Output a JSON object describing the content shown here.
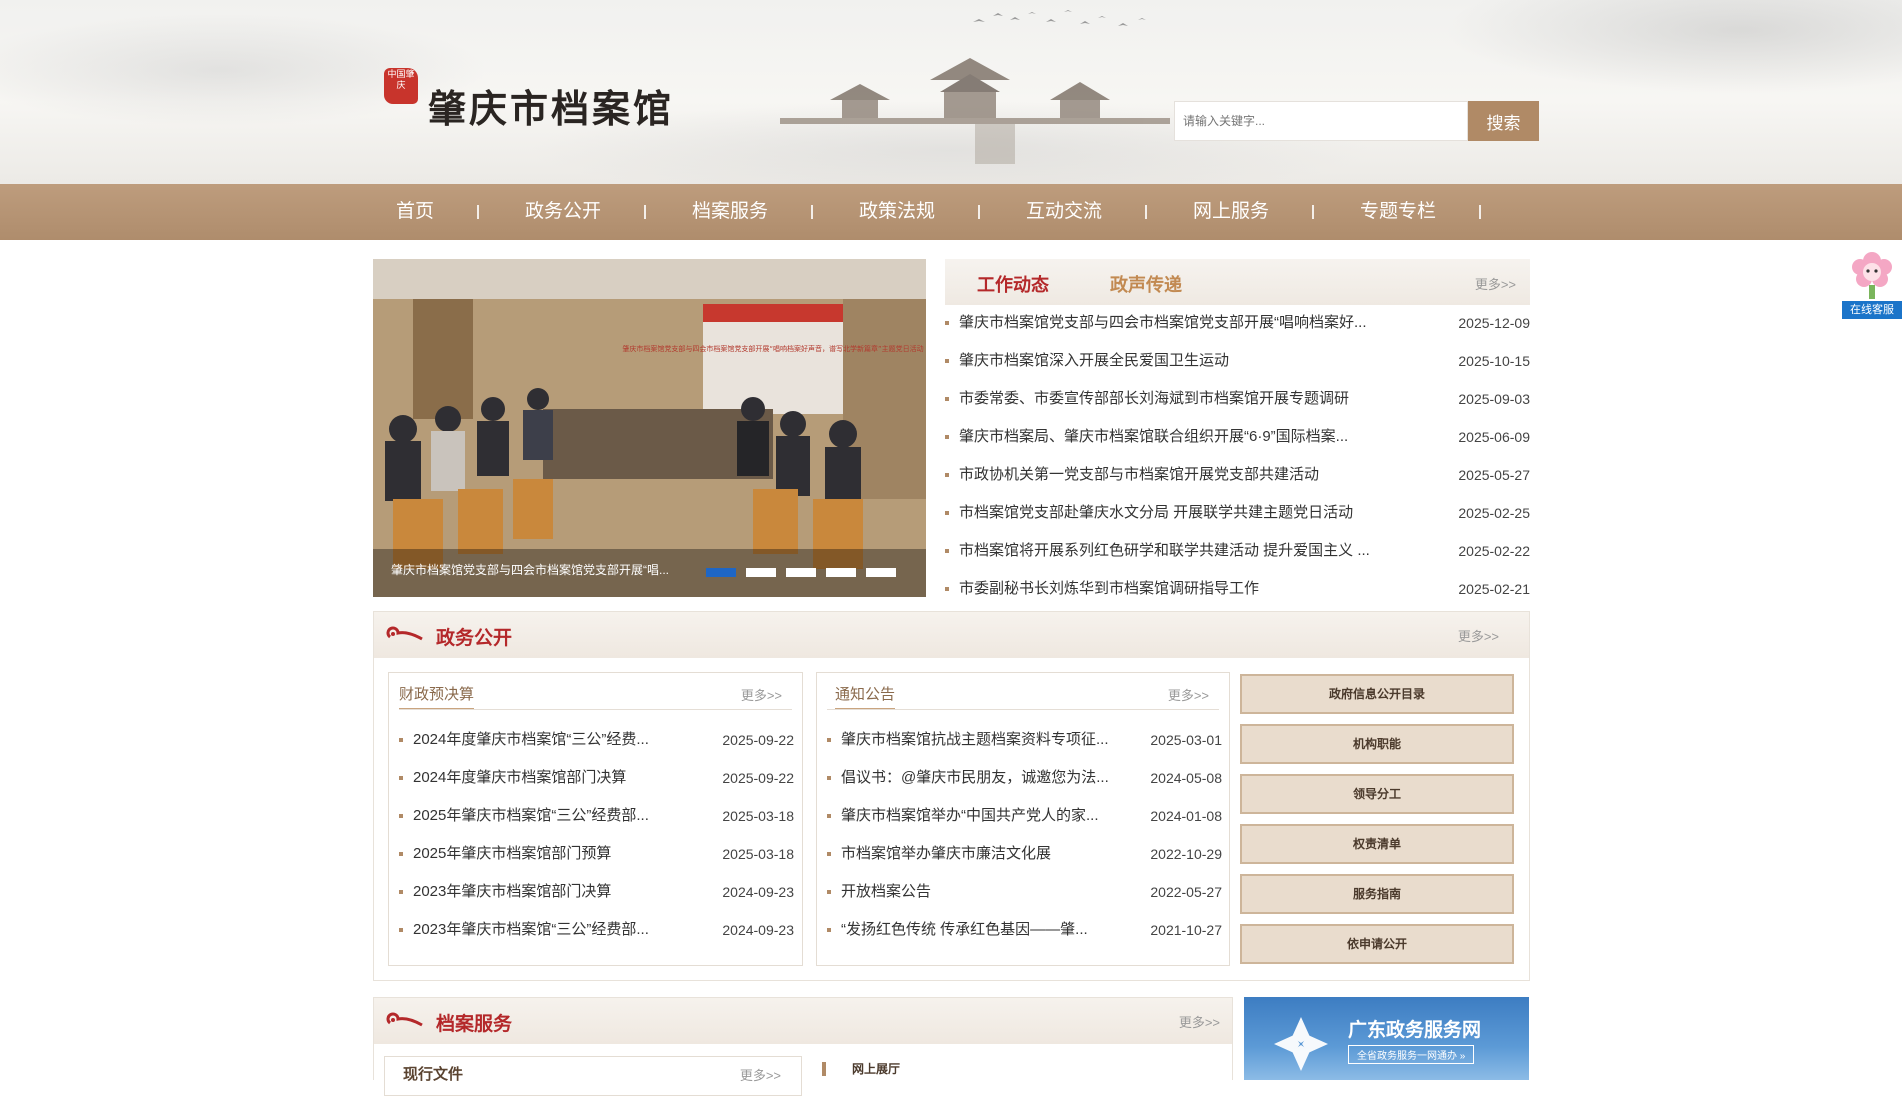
{
  "header": {
    "seal_text": "中国肇庆",
    "site_title": "肇庆市档案馆",
    "search": {
      "placeholder": "请输入关键字...",
      "button_label": "搜索"
    }
  },
  "nav": {
    "items": [
      {
        "label": "首页"
      },
      {
        "label": "政务公开"
      },
      {
        "label": "档案服务"
      },
      {
        "label": "政策法规"
      },
      {
        "label": "互动交流"
      },
      {
        "label": "网上服务"
      },
      {
        "label": "专题专栏"
      }
    ]
  },
  "carousel": {
    "caption": "肇庆市档案馆党支部与四会市档案馆党支部开展“唱...",
    "slide_count": 5,
    "active_index": 0,
    "slide_banner_text": "肇庆市档案馆党支部与四会市档案馆党支部开展“唱响档案好声音，谱写北学新篇章”主题党日活动"
  },
  "news": {
    "tabs": [
      {
        "label": "工作动态",
        "active": true
      },
      {
        "label": "政声传递",
        "active": false
      }
    ],
    "more_label": "更多>>",
    "items": [
      {
        "title": "肇庆市档案馆党支部与四会市档案馆党支部开展“唱响档案好...",
        "date": "2025-12-09"
      },
      {
        "title": "肇庆市档案馆深入开展全民爱国卫生运动",
        "date": "2025-10-15"
      },
      {
        "title": "市委常委、市委宣传部部长刘海斌到市档案馆开展专题调研",
        "date": "2025-09-03"
      },
      {
        "title": "肇庆市档案局、肇庆市档案馆联合组织开展“6·9”国际档案...",
        "date": "2025-06-09"
      },
      {
        "title": "市政协机关第一党支部与市档案馆开展党支部共建活动",
        "date": "2025-05-27"
      },
      {
        "title": "市档案馆党支部赴肇庆水文分局 开展联学共建主题党日活动",
        "date": "2025-02-25"
      },
      {
        "title": "市档案馆将开展系列红色研学和联学共建活动 提升爱国主义 ...",
        "date": "2025-02-22"
      },
      {
        "title": "市委副秘书长刘炼华到市档案馆调研指导工作",
        "date": "2025-02-21"
      }
    ]
  },
  "gov_section": {
    "title": "政务公开",
    "more_label": "更多>>",
    "finance": {
      "title": "财政预决算",
      "more_label": "更多>>",
      "items": [
        {
          "title": "2024年度肇庆市档案馆“三公”经费...",
          "date": "2025-09-22"
        },
        {
          "title": "2024年度肇庆市档案馆部门决算",
          "date": "2025-09-22"
        },
        {
          "title": "2025年肇庆市档案馆“三公”经费部...",
          "date": "2025-03-18"
        },
        {
          "title": "2025年肇庆市档案馆部门预算",
          "date": "2025-03-18"
        },
        {
          "title": "2023年肇庆市档案馆部门决算",
          "date": "2024-09-23"
        },
        {
          "title": "2023年肇庆市档案馆“三公”经费部...",
          "date": "2024-09-23"
        }
      ]
    },
    "notice": {
      "title": "通知公告",
      "more_label": "更多>>",
      "items": [
        {
          "title": "肇庆市档案馆抗战主题档案资料专项征...",
          "date": "2025-03-01"
        },
        {
          "title": "倡议书：@肇庆市民朋友，诚邀您为法...",
          "date": "2024-05-08"
        },
        {
          "title": "肇庆市档案馆举办“中国共产党人的家...",
          "date": "2024-01-08"
        },
        {
          "title": "市档案馆举办肇庆市廉洁文化展",
          "date": "2022-10-29"
        },
        {
          "title": "开放档案公告",
          "date": "2022-05-27"
        },
        {
          "title": "“发扬红色传统 传承红色基因——肇...",
          "date": "2021-10-27"
        }
      ]
    },
    "side_buttons": [
      {
        "label": "政府信息公开目录"
      },
      {
        "label": "机构职能"
      },
      {
        "label": "领导分工"
      },
      {
        "label": "权责清单"
      },
      {
        "label": "服务指南"
      },
      {
        "label": "依申请公开"
      }
    ]
  },
  "archive_section": {
    "title": "档案服务",
    "more_label": "更多>>",
    "sub_left": {
      "title": "现行文件",
      "more_label": "更多>>"
    },
    "sub_right": {
      "title": "网上展厅"
    }
  },
  "gd_banner": {
    "title": "广东政务服务网",
    "subtitle": "全省政务服务一网通办 »"
  },
  "online_service": {
    "label": "在线客服"
  },
  "colors": {
    "nav_bg": "#b89472",
    "accent_red": "#b4282a",
    "search_button": "#b08a66",
    "active_dot": "#1e66c5"
  }
}
